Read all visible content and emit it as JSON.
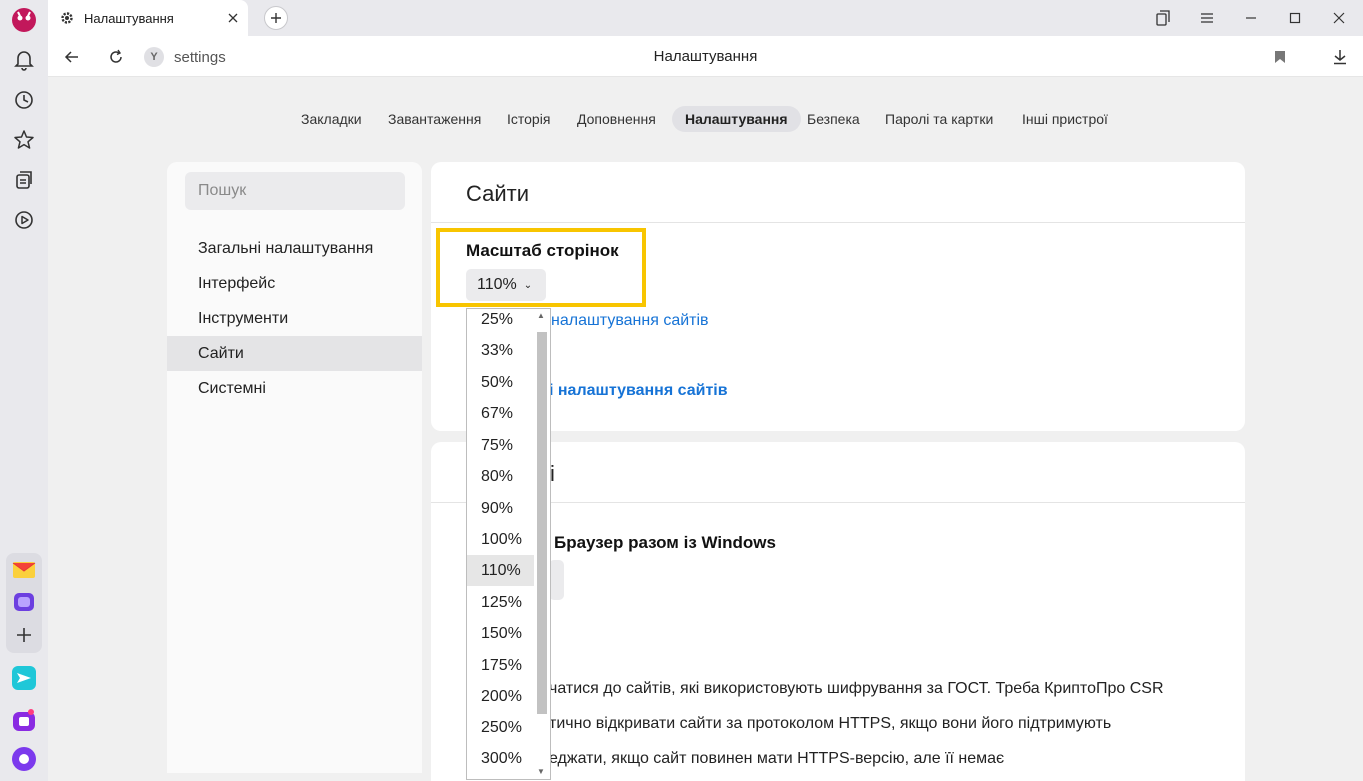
{
  "tab": {
    "title": "Налаштування"
  },
  "address": {
    "url": "settings",
    "page_title": "Налаштування"
  },
  "topnav": [
    {
      "label": "Закладки",
      "active": false
    },
    {
      "label": "Завантаження",
      "active": false
    },
    {
      "label": "Історія",
      "active": false
    },
    {
      "label": "Доповнення",
      "active": false
    },
    {
      "label": "Налаштування",
      "active": true
    },
    {
      "label": "Безпека",
      "active": false
    },
    {
      "label": "Паролі та картки",
      "active": false
    },
    {
      "label": "Інші пристрої",
      "active": false
    }
  ],
  "sidebar": {
    "search_placeholder": "Пошук",
    "items": [
      {
        "label": "Загальні налаштування",
        "active": false
      },
      {
        "label": "Інтерфейс",
        "active": false
      },
      {
        "label": "Інструменти",
        "active": false
      },
      {
        "label": "Сайти",
        "active": true
      },
      {
        "label": "Системні",
        "active": false
      }
    ]
  },
  "sites_card": {
    "title": "Сайти",
    "zoom_label": "Масштаб сторінок",
    "zoom_value": "110%",
    "link_partial_1": "налаштування сайтів",
    "link_partial_2": "і налаштування сайтів"
  },
  "system_card": {
    "title_partial": "і",
    "autostart_partial": "Браузер разом із Windows",
    "line1_partial": "чатися до сайтів, які використовують шифрування за ГОСТ. Треба КриптоПро CSR",
    "line2_partial": "тично відкривати сайти за протоколом HTTPS, якщо вони його підтримують",
    "line3_partial": "еджати, якщо сайт повинен мати HTTPS-версію, але її немає"
  },
  "zoom_dropdown": {
    "selected": "110%",
    "options": [
      "25%",
      "33%",
      "50%",
      "67%",
      "75%",
      "80%",
      "90%",
      "100%",
      "110%",
      "125%",
      "150%",
      "175%",
      "200%",
      "250%",
      "300%"
    ]
  },
  "colors": {
    "accent_link": "#1673d6",
    "highlight": "#f8c500"
  }
}
